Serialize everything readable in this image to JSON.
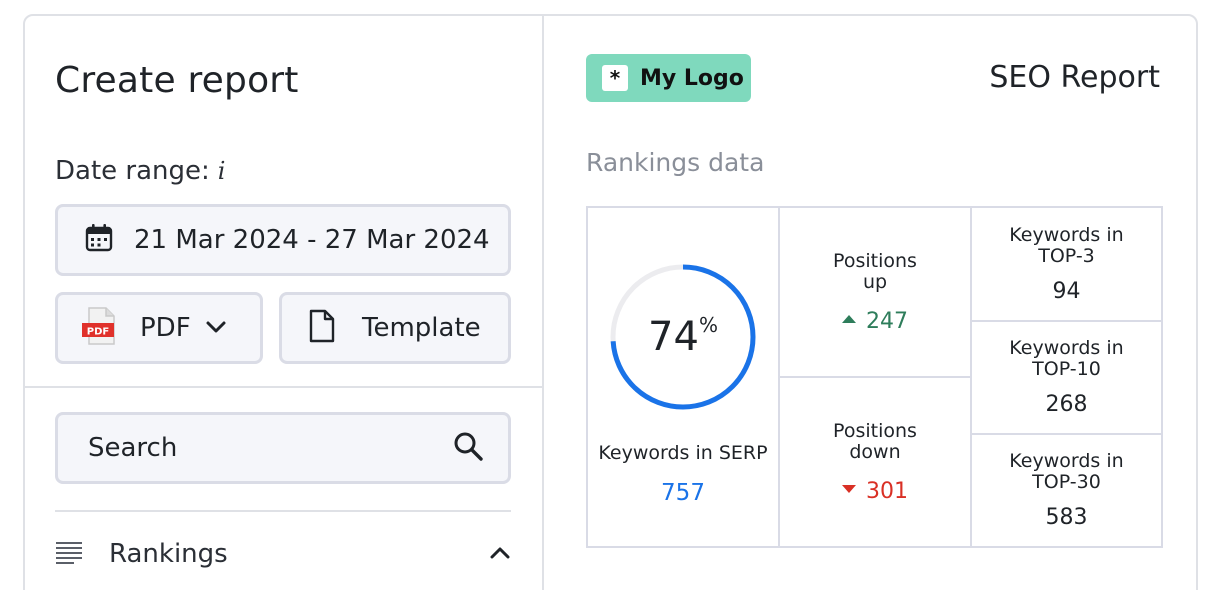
{
  "left": {
    "title": "Create report",
    "date_label": "Date range:",
    "date_info": "i",
    "date_value": "21 Mar 2024 - 27 Mar 2024",
    "format_label": "PDF",
    "pdf_icon_text": "PDF",
    "template_label": "Template",
    "search_placeholder": "Search",
    "rankings_label": "Rankings"
  },
  "right": {
    "logo_text": "My Logo",
    "report_title": "SEO Report",
    "section_title": "Rankings data",
    "keywords_serp_label": "Keywords in SERP",
    "keywords_serp_value": "757",
    "serp_percent": 74,
    "serp_percent_text": "74",
    "percent_sign": "%",
    "positions_up_label_1": "Positions",
    "positions_up_label_2": "up",
    "positions_up_value": "247",
    "positions_down_label_1": "Positions",
    "positions_down_label_2": "down",
    "positions_down_value": "301",
    "top3_label_1": "Keywords in",
    "top3_label_2": "TOP-3",
    "top3_value": "94",
    "top10_label_1": "Keywords in",
    "top10_label_2": "TOP-10",
    "top10_value": "268",
    "top30_label_1": "Keywords in",
    "top30_label_2": "TOP-30",
    "top30_value": "583"
  },
  "colors": {
    "accent_blue": "#1a73e8",
    "up_green": "#2e7d5b",
    "down_red": "#d93025",
    "logo_bg": "#7fd9bd"
  }
}
